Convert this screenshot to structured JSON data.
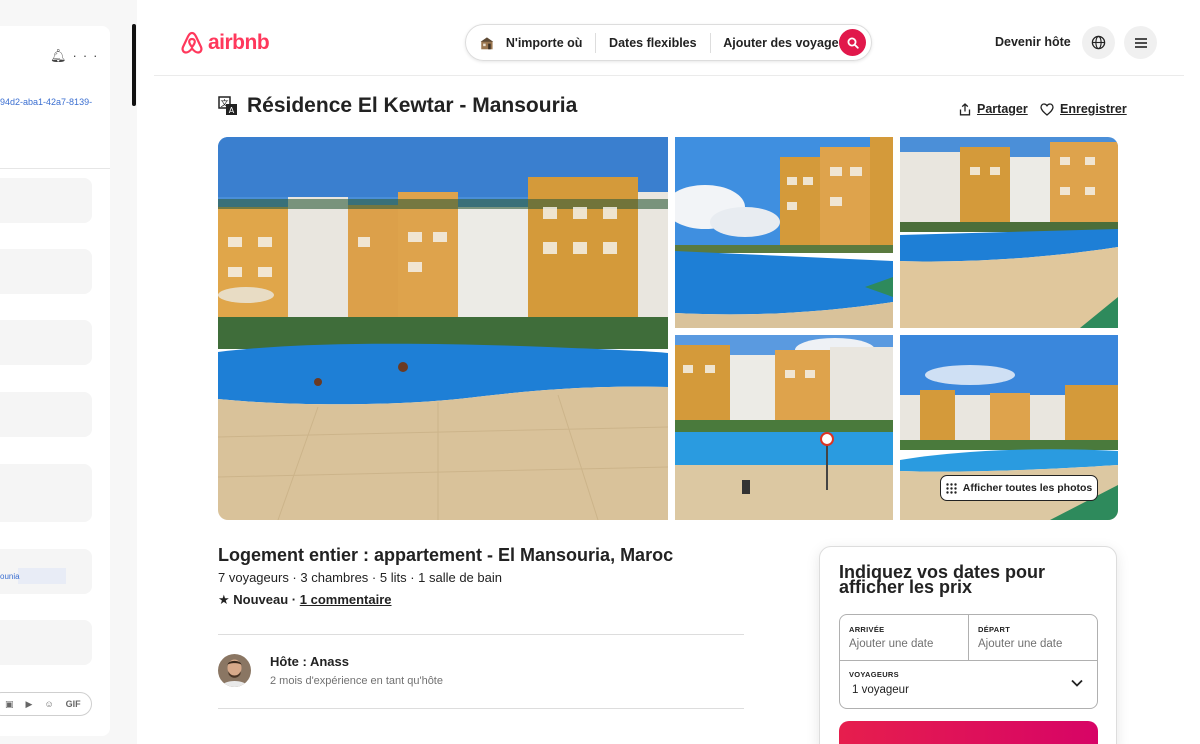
{
  "side_panel": {
    "link_text": "94d2-aba1-42a7-8139-",
    "mini_text": "ounia",
    "input_gif_label": "GIF"
  },
  "header": {
    "logo_text": "airbnb",
    "search": {
      "where": "N'importe où",
      "when": "Dates flexibles",
      "who": "Ajouter des voyageurs"
    },
    "host_link": "Devenir hôte"
  },
  "listing": {
    "title": "Résidence El Kewtar - Mansouria",
    "share_label": "Partager",
    "save_label": "Enregistrer",
    "show_all_photos": "Afficher toutes les photos",
    "subtitle": "Logement entier : appartement - El Mansouria, Maroc",
    "capacity": "7 voyageurs · 3 chambres · 5 lits · 1 salle de bain",
    "rating_status": "Nouveau",
    "rating_sep": " · ",
    "reviews_link": "1 commentaire"
  },
  "host": {
    "name": "Hôte : Anass",
    "experience": "2 mois d'expérience en tant qu'hôte"
  },
  "booking": {
    "title": "Indiquez vos dates pour afficher les prix",
    "checkin_label": "ARRIVÉE",
    "checkin_value": "Ajouter une date",
    "checkout_label": "DÉPART",
    "checkout_value": "Ajouter une date",
    "guests_label": "VOYAGEURS",
    "guests_value": "1 voyageur"
  },
  "colors": {
    "brand": "#ff385c",
    "search_button": "#e1184b",
    "pool": "#1e7fd6",
    "building": "#d49a3a"
  }
}
